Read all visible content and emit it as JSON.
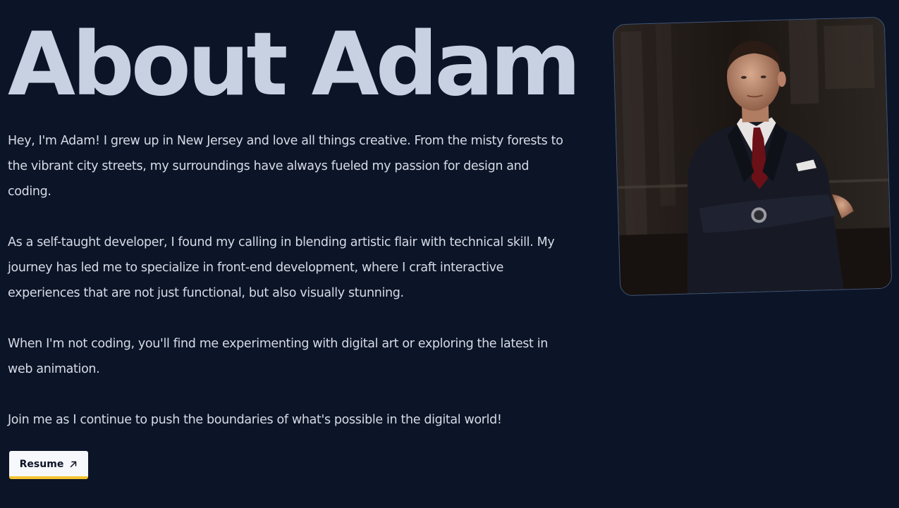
{
  "about": {
    "title": "About Adam",
    "paragraphs": [
      "Hey, I'm Adam! I grew up in New Jersey and love all things creative. From the misty forests to the vibrant city streets, my surroundings have always fueled my passion for design and coding.",
      "As a self-taught developer, I found my calling in blending artistic flair with technical skill. My journey has led me to specialize in front-end development, where I craft interactive experiences that are not just functional, but also visually stunning.",
      "When I'm not coding, you'll find me experimenting with digital art or exploring the latest in web animation.",
      "Join me as I continue to push the boundaries of what's possible in the digital world!"
    ],
    "resume_button": {
      "label": "Resume",
      "icon": "arrow-up-right-icon"
    },
    "portrait": {
      "alt": "Portrait of Adam"
    }
  },
  "colors": {
    "background": "#0c1427",
    "title": "#c8d1e2",
    "text": "#d6dbe6",
    "button_bg": "#f7f8fb",
    "button_accent": "#f4c430",
    "frame_border": "#41577a"
  }
}
